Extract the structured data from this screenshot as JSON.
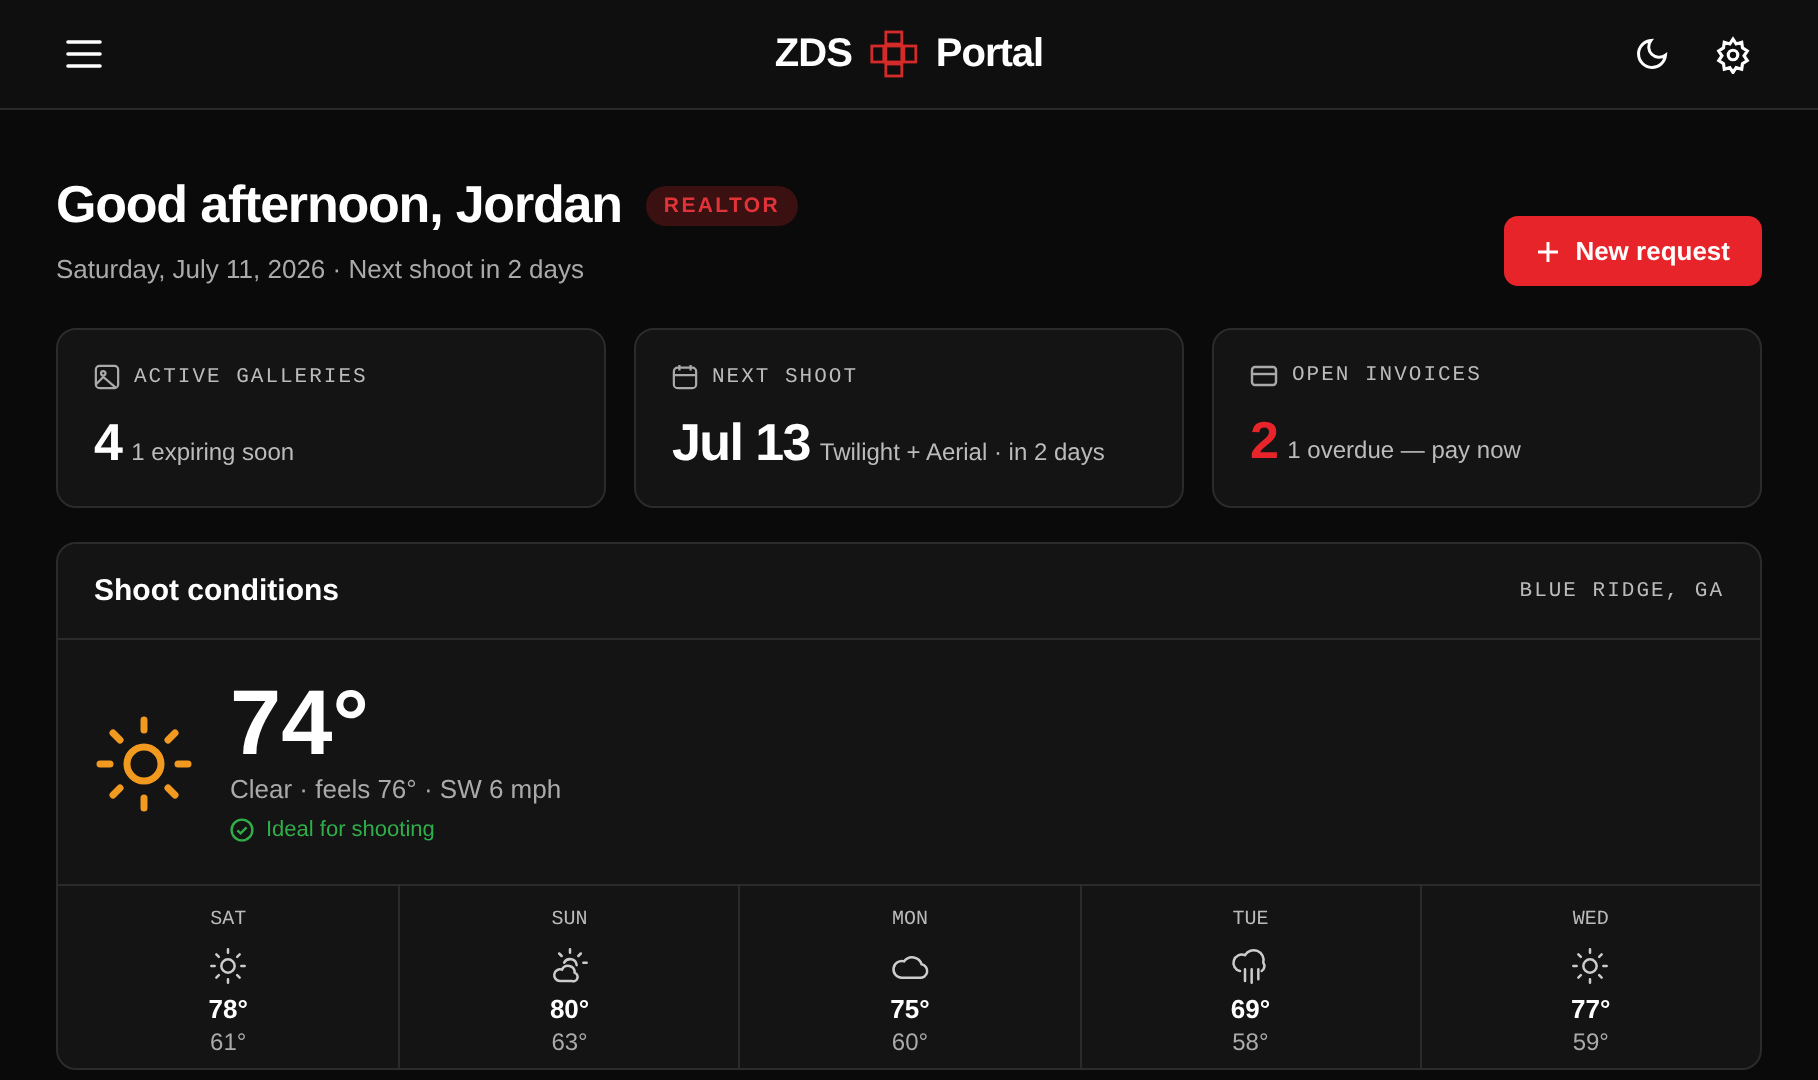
{
  "header": {
    "brand_left": "ZDS",
    "brand_right": "Portal"
  },
  "greeting": {
    "title": "Good afternoon, Jordan",
    "badge": "REALTOR",
    "subtitle": "Saturday, July 11, 2026 · Next shoot in 2 days",
    "button": "New request"
  },
  "stats": [
    {
      "kind": "gallery",
      "label": "ACTIVE GALLERIES",
      "value": "4",
      "detail": "1 expiring soon",
      "urgent": false
    },
    {
      "kind": "calendar",
      "label": "NEXT SHOOT",
      "value": "Jul 13",
      "detail": "Twilight + Aerial · in 2 days",
      "urgent": false
    },
    {
      "kind": "card",
      "label": "OPEN INVOICES",
      "value": "2",
      "detail": "1 overdue — pay now",
      "urgent": true
    }
  ],
  "conditions": {
    "title": "Shoot conditions",
    "location": "BLUE RIDGE, GA",
    "temperature": "74°",
    "summary": "Clear · feels 76° · SW 6 mph",
    "status": "Ideal for shooting",
    "ideal": true,
    "forecast": [
      {
        "day": "SAT",
        "kind": "sun",
        "high": "78°",
        "low": "61°"
      },
      {
        "day": "SUN",
        "kind": "partly",
        "high": "80°",
        "low": "63°"
      },
      {
        "day": "MON",
        "kind": "cloud",
        "high": "75°",
        "low": "60°"
      },
      {
        "day": "TUE",
        "kind": "rain",
        "high": "69°",
        "low": "58°"
      },
      {
        "day": "WED",
        "kind": "sun",
        "high": "77°",
        "low": "59°"
      }
    ]
  }
}
